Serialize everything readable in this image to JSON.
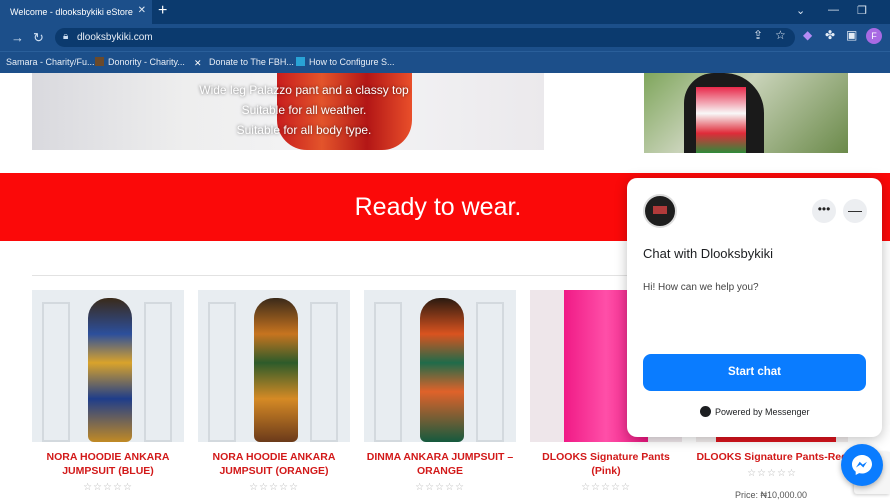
{
  "browser": {
    "tab_title": "Welcome - dlooksbykiki eStore",
    "url": "dlooksbykiki.com",
    "profile_initial": "F",
    "bookmarks": [
      {
        "label": "Samara - Charity/Fu..."
      },
      {
        "label": "Donority - Charity..."
      },
      {
        "label": "Donate to The FBH..."
      },
      {
        "label": "How to Configure S..."
      }
    ]
  },
  "hero": {
    "lines": [
      "Wide leg Palazzo pant and a classy top",
      "Suitable for all weather.",
      "Suitable for all body type."
    ]
  },
  "banner": {
    "text": "Ready to wear."
  },
  "products": [
    {
      "name_line1": "NORA HOODIE ANKARA",
      "name_line2": "JUMPSUIT (BLUE)"
    },
    {
      "name_line1": "NORA HOODIE ANKARA",
      "name_line2": "JUMPSUIT (ORANGE)"
    },
    {
      "name_line1": "DINMA ANKARA JUMPSUIT –",
      "name_line2": "ORANGE"
    },
    {
      "name_line1": "DLOOKS Signature Pants",
      "name_line2": "(Pink)"
    },
    {
      "name_line1": "DLOOKS Signature Pants-Red",
      "name_line2": ""
    }
  ],
  "stars_text": "☆☆☆☆☆",
  "price_partial": "Price: ₦10,000.00",
  "chat": {
    "title": "Chat with Dlooksbykiki",
    "message": "Hi! How can we help you?",
    "start_button": "Start chat",
    "powered_by": "Powered by Messenger"
  },
  "colors": {
    "accent_red": "#fb0909",
    "product_name": "#d21919",
    "messenger_blue": "#0a7cff",
    "browser_frame": "#1c4f8a"
  }
}
